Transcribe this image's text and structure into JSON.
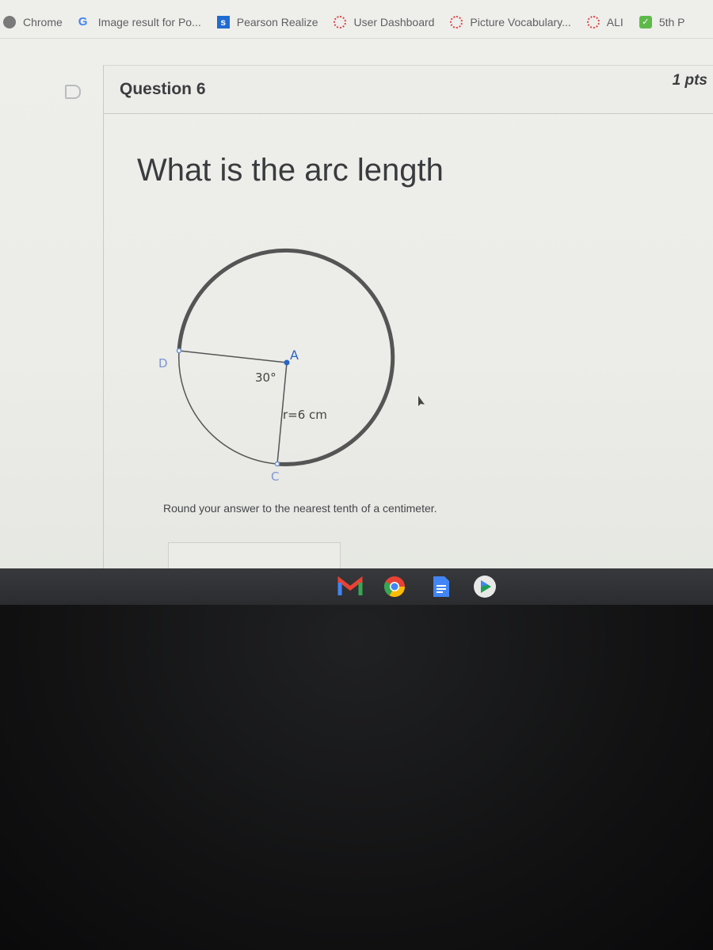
{
  "bookmarks": [
    {
      "label": "Chrome",
      "icon": "globe-icon"
    },
    {
      "label": "Image result for Po...",
      "icon": "google-icon"
    },
    {
      "label": "Pearson Realize",
      "icon": "pearson-icon"
    },
    {
      "label": "User Dashboard",
      "icon": "loading-icon"
    },
    {
      "label": "Picture Vocabulary...",
      "icon": "loading-icon"
    },
    {
      "label": "ALI",
      "icon": "loading-icon"
    },
    {
      "label": "5th P",
      "icon": "check-icon"
    }
  ],
  "question": {
    "title": "Question 6",
    "points": "1 pts",
    "prompt": "What is the arc length",
    "instruction": "Round your answer to the nearest tenth of a centimeter.",
    "answer_value": ""
  },
  "diagram": {
    "center_label": "A",
    "point_d_label": "D",
    "point_c_label": "C",
    "angle_label": "30°",
    "radius_label": "r=6 cm",
    "angle_degrees": 30,
    "radius_cm": 6
  },
  "shelf": {
    "apps": [
      {
        "name": "Gmail",
        "icon": "gmail-icon"
      },
      {
        "name": "Chrome",
        "icon": "chrome-icon"
      },
      {
        "name": "Docs",
        "icon": "docs-icon"
      },
      {
        "name": "Play Store",
        "icon": "play-store-icon"
      }
    ]
  }
}
